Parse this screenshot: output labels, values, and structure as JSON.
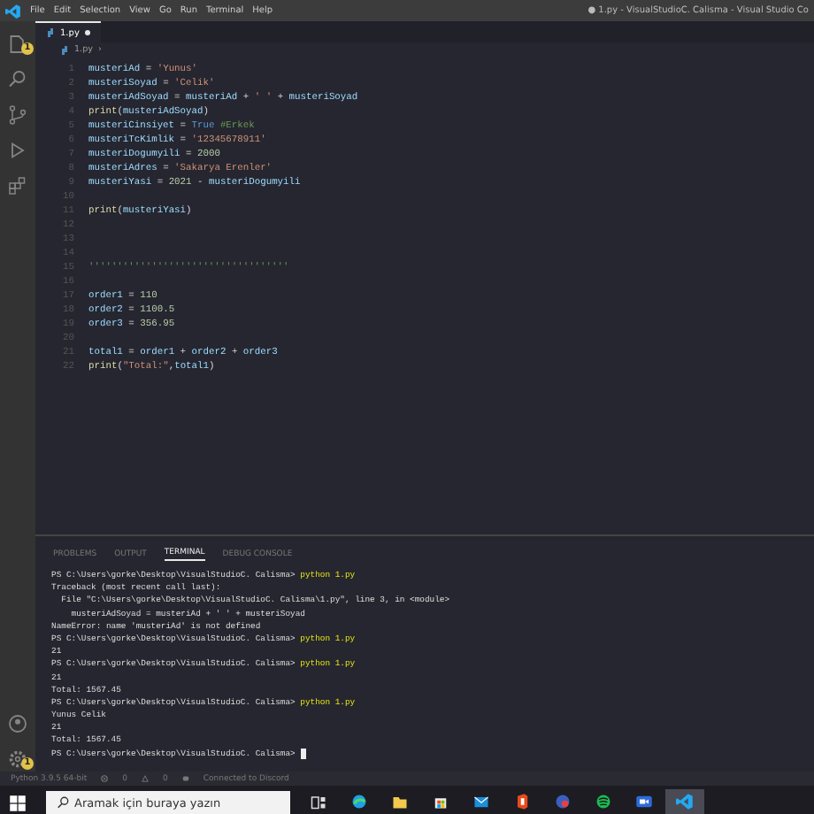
{
  "title_bar": {
    "menu": [
      "File",
      "Edit",
      "Selection",
      "View",
      "Go",
      "Run",
      "Terminal",
      "Help"
    ],
    "title": "● 1.py - VisualStudioC. Calisma - Visual Studio Co"
  },
  "activity_bar": {
    "top": [
      {
        "kind": "files",
        "badge": "1"
      },
      {
        "kind": "search"
      },
      {
        "kind": "source-control"
      },
      {
        "kind": "run"
      },
      {
        "kind": "extensions"
      }
    ],
    "bottom": [
      {
        "kind": "account"
      },
      {
        "kind": "settings",
        "badge": "1"
      }
    ]
  },
  "tabs": [
    {
      "label": "1.py",
      "selected": true,
      "modified": true
    }
  ],
  "breadcrumb": {
    "file": "1.py",
    "separator": "›"
  },
  "editor": {
    "lines": [
      {
        "number": "1",
        "tokens": [
          {
            "kind": "var",
            "text": "musteriAd"
          },
          {
            "kind": "op",
            "text": " = "
          },
          {
            "kind": "str",
            "text": "'Yunus'"
          }
        ]
      },
      {
        "number": "2",
        "tokens": [
          {
            "kind": "var",
            "text": "musteriSoyad"
          },
          {
            "kind": "op",
            "text": " = "
          },
          {
            "kind": "str",
            "text": "'Celik'"
          }
        ]
      },
      {
        "number": "3",
        "tokens": [
          {
            "kind": "var",
            "text": "musteriAdSoyad"
          },
          {
            "kind": "op",
            "text": " = "
          },
          {
            "kind": "var",
            "text": "musteriAd"
          },
          {
            "kind": "op",
            "text": " + "
          },
          {
            "kind": "str",
            "text": "' '"
          },
          {
            "kind": "op",
            "text": " + "
          },
          {
            "kind": "var",
            "text": "musteriSoyad"
          }
        ]
      },
      {
        "number": "4",
        "tokens": [
          {
            "kind": "fn",
            "text": "print"
          },
          {
            "kind": "op",
            "text": "("
          },
          {
            "kind": "var",
            "text": "musteriAdSoyad"
          },
          {
            "kind": "op",
            "text": ")"
          }
        ]
      },
      {
        "number": "5",
        "tokens": [
          {
            "kind": "var",
            "text": "musteriCinsiyet"
          },
          {
            "kind": "op",
            "text": " = "
          },
          {
            "kind": "bool",
            "text": "True"
          },
          {
            "kind": "comment",
            "text": " #Erkek"
          }
        ]
      },
      {
        "number": "6",
        "tokens": [
          {
            "kind": "var",
            "text": "musteriTcKimlik"
          },
          {
            "kind": "op",
            "text": " = "
          },
          {
            "kind": "str",
            "text": "'12345678911'"
          }
        ]
      },
      {
        "number": "7",
        "tokens": [
          {
            "kind": "var",
            "text": "musteriDogumyili"
          },
          {
            "kind": "op",
            "text": " = "
          },
          {
            "kind": "num",
            "text": "2000"
          }
        ]
      },
      {
        "number": "8",
        "tokens": [
          {
            "kind": "var",
            "text": "musteriAdres"
          },
          {
            "kind": "op",
            "text": " = "
          },
          {
            "kind": "str",
            "text": "'Sakarya Erenler'"
          }
        ]
      },
      {
        "number": "9",
        "tokens": [
          {
            "kind": "var",
            "text": "musteriYasi"
          },
          {
            "kind": "op",
            "text": " = "
          },
          {
            "kind": "num",
            "text": "2021"
          },
          {
            "kind": "op",
            "text": " - "
          },
          {
            "kind": "var",
            "text": "musteriDogumyili"
          }
        ]
      },
      {
        "number": "10"
      },
      {
        "number": "11",
        "tokens": [
          {
            "kind": "fn",
            "text": "print"
          },
          {
            "kind": "op",
            "text": "("
          },
          {
            "kind": "var",
            "text": "musteriYasi"
          },
          {
            "kind": "op",
            "text": ")"
          }
        ]
      },
      {
        "number": "12"
      },
      {
        "number": "13"
      },
      {
        "number": "14"
      },
      {
        "number": "15",
        "tokens": [
          {
            "kind": "comment",
            "text": "'''''''''''''''''''''''''''''''''''"
          }
        ]
      },
      {
        "number": "16"
      },
      {
        "number": "17",
        "tokens": [
          {
            "kind": "var",
            "text": "order1"
          },
          {
            "kind": "op",
            "text": " = "
          },
          {
            "kind": "num",
            "text": "110"
          }
        ]
      },
      {
        "number": "18",
        "tokens": [
          {
            "kind": "var",
            "text": "order2"
          },
          {
            "kind": "op",
            "text": " = "
          },
          {
            "kind": "num",
            "text": "1100.5"
          }
        ]
      },
      {
        "number": "19",
        "tokens": [
          {
            "kind": "var",
            "text": "order3"
          },
          {
            "kind": "op",
            "text": " = "
          },
          {
            "kind": "num",
            "text": "356.95"
          }
        ]
      },
      {
        "number": "20"
      },
      {
        "number": "21",
        "tokens": [
          {
            "kind": "var",
            "text": "total1"
          },
          {
            "kind": "op",
            "text": " = "
          },
          {
            "kind": "var",
            "text": "order1"
          },
          {
            "kind": "op",
            "text": " + "
          },
          {
            "kind": "var",
            "text": "order2"
          },
          {
            "kind": "op",
            "text": " + "
          },
          {
            "kind": "var",
            "text": "order3"
          }
        ]
      },
      {
        "number": "22",
        "tokens": [
          {
            "kind": "fn",
            "text": "print"
          },
          {
            "kind": "op",
            "text": "("
          },
          {
            "kind": "str",
            "text": "\"Total:\""
          },
          {
            "kind": "op",
            "text": ","
          },
          {
            "kind": "var",
            "text": "total1"
          },
          {
            "kind": "op",
            "text": ")"
          }
        ]
      }
    ]
  },
  "panel": {
    "tabs": [
      {
        "label": "PROBLEMS",
        "selected": false
      },
      {
        "label": "OUTPUT",
        "selected": false
      },
      {
        "label": "TERMINAL",
        "selected": true
      },
      {
        "label": "DEBUG CONSOLE",
        "selected": false
      }
    ],
    "terminal": [
      {
        "kind": "prompt",
        "prompt": "PS C:\\Users\\gorke\\Desktop\\VisualStudioC. Calisma> ",
        "command": "python 1.py"
      },
      {
        "kind": "output",
        "text": "Traceback (most recent call last):"
      },
      {
        "kind": "output",
        "text": "  File \"C:\\Users\\gorke\\Desktop\\VisualStudioC. Calisma\\1.py\", line 3, in <module>"
      },
      {
        "kind": "output",
        "text": "    musteriAdSoyad = musteriAd + ' ' + musteriSoyad"
      },
      {
        "kind": "output",
        "text": "NameError: name 'musteriAd' is not defined"
      },
      {
        "kind": "prompt",
        "prompt": "PS C:\\Users\\gorke\\Desktop\\VisualStudioC. Calisma> ",
        "command": "python 1.py"
      },
      {
        "kind": "output",
        "text": "21"
      },
      {
        "kind": "prompt",
        "prompt": "PS C:\\Users\\gorke\\Desktop\\VisualStudioC. Calisma> ",
        "command": "python 1.py"
      },
      {
        "kind": "output",
        "text": "21"
      },
      {
        "kind": "output",
        "text": "Total: 1567.45"
      },
      {
        "kind": "prompt",
        "prompt": "PS C:\\Users\\gorke\\Desktop\\VisualStudioC. Calisma> ",
        "command": "python 1.py"
      },
      {
        "kind": "output",
        "text": "Yunus Celik"
      },
      {
        "kind": "output",
        "text": "21"
      },
      {
        "kind": "output",
        "text": "Total: 1567.45"
      },
      {
        "kind": "prompt",
        "prompt": "PS C:\\Users\\gorke\\Desktop\\VisualStudioC. Calisma> ",
        "cursor": true
      }
    ]
  },
  "status_bar": {
    "items": [
      {
        "kind": "text",
        "text": "Python 3.9.5 64-bit"
      },
      {
        "kind": "problems",
        "errors": "0",
        "warnings": "0"
      },
      {
        "kind": "discord",
        "text": "Connected to Discord"
      }
    ]
  },
  "taskbar": {
    "search": {
      "placeholder": "Aramak için buraya yazın"
    },
    "apps": [
      {
        "kind": "task-view",
        "selected": false
      },
      {
        "kind": "browser",
        "selected": false
      },
      {
        "kind": "folder",
        "selected": false
      },
      {
        "kind": "store",
        "selected": false
      },
      {
        "kind": "mail",
        "selected": false
      },
      {
        "kind": "office",
        "selected": false
      },
      {
        "kind": "app",
        "selected": false
      },
      {
        "kind": "music",
        "selected": false
      },
      {
        "kind": "video",
        "selected": false
      },
      {
        "kind": "editor",
        "selected": true
      }
    ]
  }
}
